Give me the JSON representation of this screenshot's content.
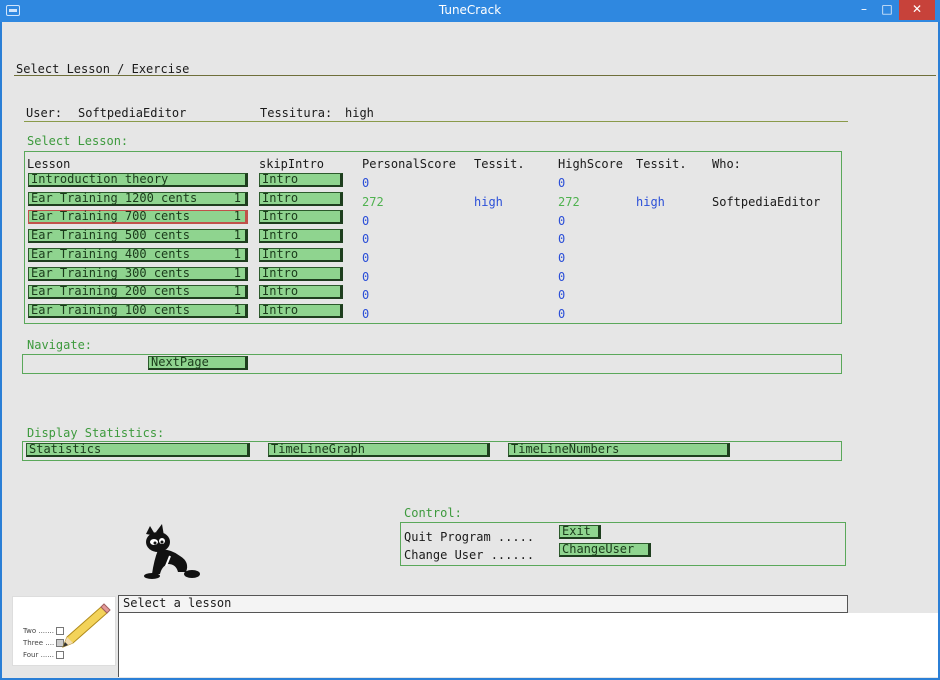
{
  "window": {
    "title": "TuneCrack",
    "minimize": "–",
    "maximize": "□",
    "close": "✕"
  },
  "page_title": "Select Lesson / Exercise",
  "user_line": {
    "user_label": "User:",
    "user_value": "SoftpediaEditor",
    "tessitura_label": "Tessitura:",
    "tessitura_value": "high"
  },
  "select_lesson": {
    "section_label": "Select Lesson:",
    "headers": {
      "lesson": "Lesson",
      "skip": "skipIntro",
      "personal": "PersonalScore",
      "tessit1": "Tessit.",
      "high": "HighScore",
      "tessit2": "Tessit.",
      "who": "Who:"
    },
    "rows": [
      {
        "lesson": "Introduction theory",
        "count": "",
        "intro": "Intro",
        "personal": "0",
        "tessit1": "",
        "high": "0",
        "tessit2": "",
        "who": ""
      },
      {
        "lesson": "Ear Training 1200 cents",
        "count": "1",
        "intro": "Intro",
        "personal": "272",
        "tessit1": "high",
        "high": "272",
        "tessit2": "high",
        "who": "SoftpediaEditor"
      },
      {
        "lesson": "Ear Training 700 cents",
        "count": "1",
        "intro": "Intro",
        "personal": "0",
        "tessit1": "",
        "high": "0",
        "tessit2": "",
        "who": ""
      },
      {
        "lesson": "Ear Training 500 cents",
        "count": "1",
        "intro": "Intro",
        "personal": "0",
        "tessit1": "",
        "high": "0",
        "tessit2": "",
        "who": ""
      },
      {
        "lesson": "Ear Training 400 cents",
        "count": "1",
        "intro": "Intro",
        "personal": "0",
        "tessit1": "",
        "high": "0",
        "tessit2": "",
        "who": ""
      },
      {
        "lesson": "Ear Training 300 cents",
        "count": "1",
        "intro": "Intro",
        "personal": "0",
        "tessit1": "",
        "high": "0",
        "tessit2": "",
        "who": ""
      },
      {
        "lesson": "Ear Training 200 cents",
        "count": "1",
        "intro": "Intro",
        "personal": "0",
        "tessit1": "",
        "high": "0",
        "tessit2": "",
        "who": ""
      },
      {
        "lesson": "Ear Training 100 cents",
        "count": "1",
        "intro": "Intro",
        "personal": "0",
        "tessit1": "",
        "high": "0",
        "tessit2": "",
        "who": ""
      }
    ]
  },
  "navigate": {
    "section_label": "Navigate:",
    "next_page": "NextPage"
  },
  "statistics": {
    "section_label": "Display Statistics:",
    "statistics": "Statistics",
    "timeline_graph": "TimeLineGraph",
    "timeline_numbers": "TimeLineNumbers"
  },
  "control": {
    "section_label": "Control:",
    "quit_label": "Quit Program .....",
    "exit_button": "Exit",
    "change_label": "Change User ......",
    "change_button": "ChangeUser"
  },
  "status": {
    "message": "Select a lesson"
  },
  "thumbnail": {
    "two": "Two .......",
    "three": "Three ....",
    "four": "Four ......"
  }
}
